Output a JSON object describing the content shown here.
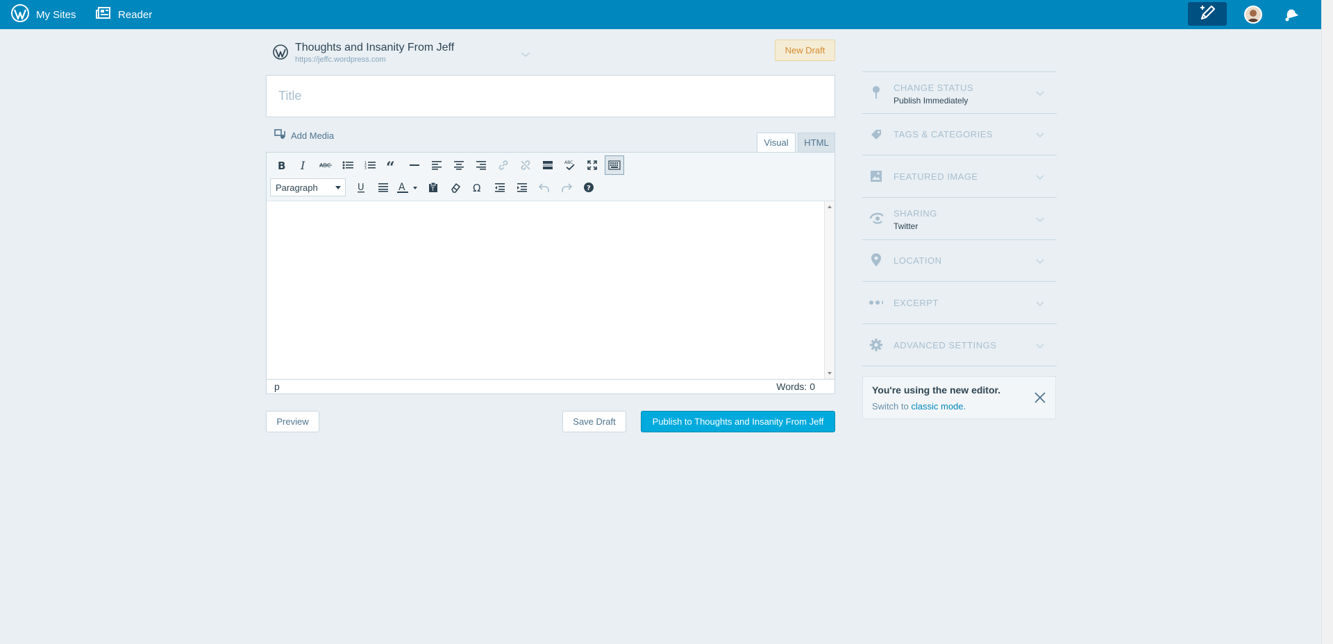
{
  "masterbar": {
    "my_sites": "My Sites",
    "reader": "Reader"
  },
  "site": {
    "title": "Thoughts and Insanity From Jeff",
    "url": "https://jeffc.wordpress.com",
    "badge": "New Draft"
  },
  "editor": {
    "title_placeholder": "Title",
    "add_media": "Add Media",
    "tabs": {
      "visual": "Visual",
      "html": "HTML"
    },
    "format_select": "Paragraph",
    "path": "p",
    "word_count": "Words: 0"
  },
  "actions": {
    "preview": "Preview",
    "save_draft": "Save Draft",
    "publish": "Publish to Thoughts and Insanity From Jeff"
  },
  "sidebar": {
    "sections": [
      {
        "title": "CHANGE STATUS",
        "subtitle": "Publish Immediately",
        "icon": "pin-icon"
      },
      {
        "title": "TAGS & CATEGORIES",
        "subtitle": "",
        "icon": "tag-icon"
      },
      {
        "title": "FEATURED IMAGE",
        "subtitle": "",
        "icon": "image-icon"
      },
      {
        "title": "SHARING",
        "subtitle": "Twitter",
        "icon": "share-icon"
      },
      {
        "title": "LOCATION",
        "subtitle": "",
        "icon": "location-icon"
      },
      {
        "title": "EXCERPT",
        "subtitle": "",
        "icon": "ellipsis-icon"
      },
      {
        "title": "ADVANCED SETTINGS",
        "subtitle": "",
        "icon": "gear-icon"
      }
    ],
    "notice": {
      "title": "You're using the new editor.",
      "text_prefix": "Switch to",
      "link": "classic mode."
    }
  },
  "colors": {
    "masterbar": "#0087be",
    "background": "#e9eff3",
    "publish_button": "#00aadc",
    "draft_badge_text": "#d58a30"
  }
}
